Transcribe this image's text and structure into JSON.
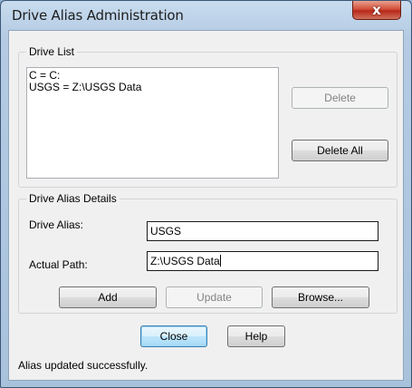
{
  "window": {
    "title": "Drive Alias Administration",
    "close_glyph": "x"
  },
  "drive_list": {
    "label": "Drive List",
    "items": [
      "C = C:",
      "USGS = Z:\\USGS Data"
    ],
    "delete_label": "Delete",
    "delete_all_label": "Delete All"
  },
  "details": {
    "label": "Drive Alias Details",
    "alias_label": "Drive Alias:",
    "alias_value": "USGS",
    "path_label": "Actual Path:",
    "path_value": "Z:\\USGS Data",
    "add_label": "Add",
    "update_label": "Update",
    "browse_label": "Browse..."
  },
  "footer": {
    "close_label": "Close",
    "help_label": "Help",
    "status": "Alias updated successfully."
  },
  "colors": {
    "close_button": "#c8402c",
    "default_button_border": "#3c7fb1"
  }
}
